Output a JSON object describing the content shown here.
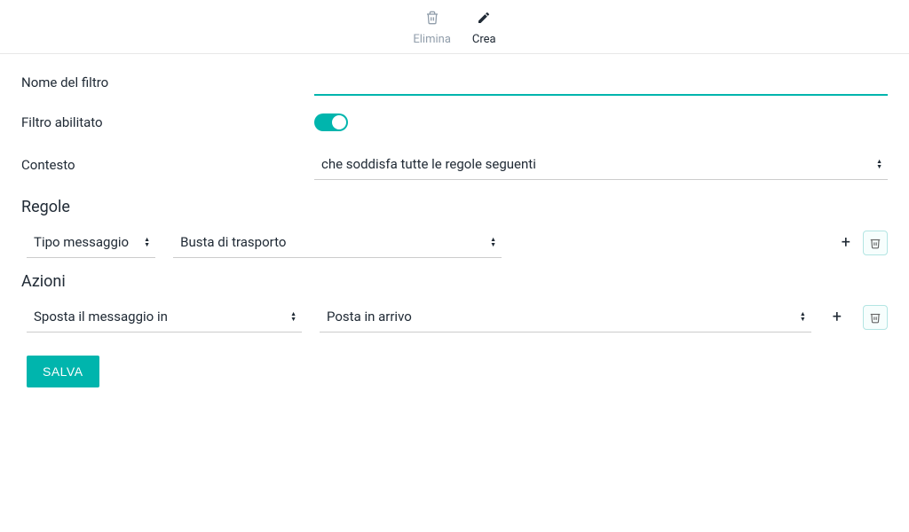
{
  "topActions": {
    "delete": {
      "label": "Elimina"
    },
    "create": {
      "label": "Crea"
    }
  },
  "form": {
    "filterName": {
      "label": "Nome del filtro",
      "value": ""
    },
    "filterEnabled": {
      "label": "Filtro abilitato",
      "value": true
    },
    "context": {
      "label": "Contesto",
      "selected": "che soddisfa tutte le regole seguenti"
    }
  },
  "rules": {
    "heading": "Regole",
    "items": [
      {
        "field": "Tipo messaggio",
        "value": "Busta di trasporto"
      }
    ]
  },
  "actions": {
    "heading": "Azioni",
    "items": [
      {
        "action": "Sposta il messaggio in",
        "target": "Posta in arrivo"
      }
    ]
  },
  "buttons": {
    "save": "SALVA"
  }
}
